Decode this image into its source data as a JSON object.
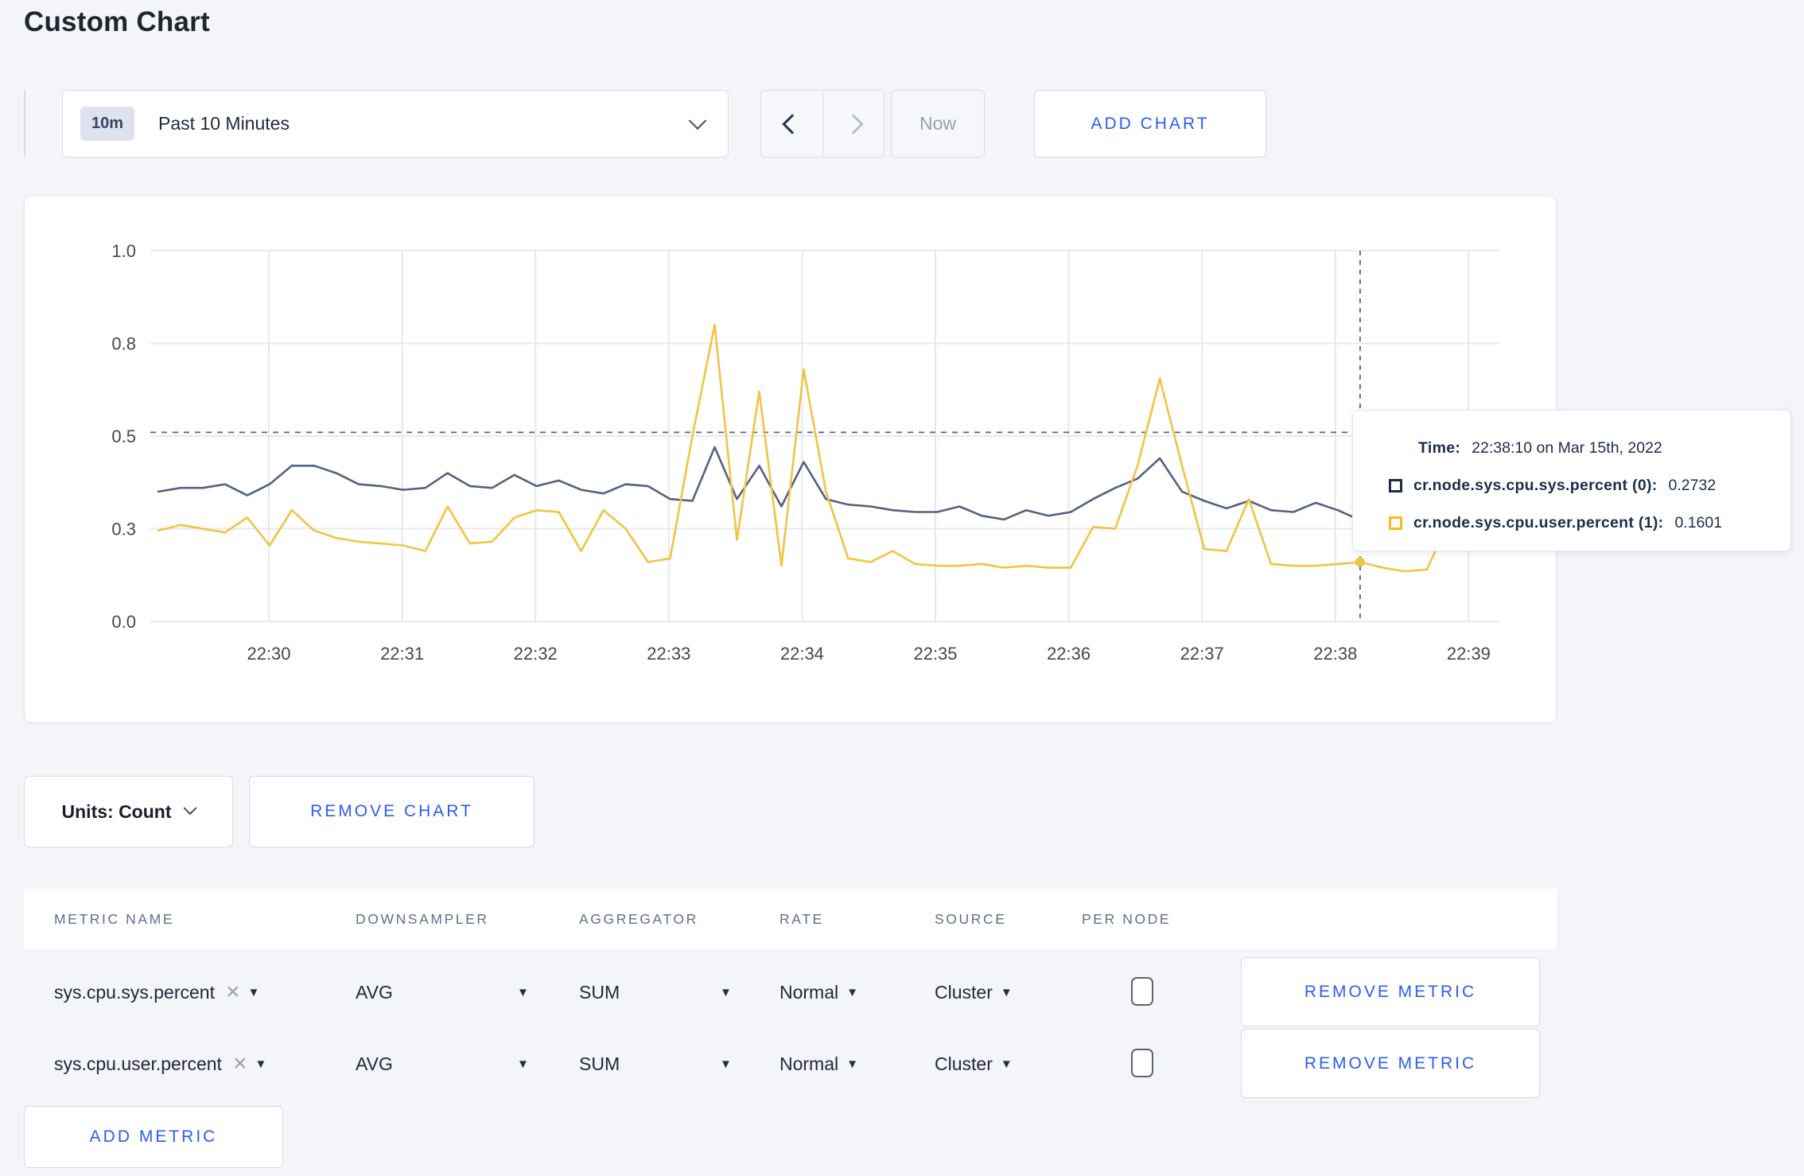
{
  "page": {
    "title": "Custom Chart"
  },
  "colors": {
    "accent_blue": "#2c5cf2",
    "background": "#f3f5f9",
    "series_sys_line": "#53627e",
    "series_user_line": "#f2c343",
    "legend_sys_square": "#1d2c49",
    "legend_user_square": "#f5bd16",
    "grid_line": "#e9eaee",
    "crosshair": "#54657f"
  },
  "toolbar": {
    "time_range_badge": "10m",
    "time_range_label": "Past 10 Minutes",
    "now_label": "Now",
    "add_chart_label": "ADD CHART"
  },
  "chart_data": {
    "type": "line",
    "title": "",
    "xlabel": "",
    "ylabel": "",
    "x_start": "22:29:10",
    "x_interval_seconds": 10,
    "x_tick_labels": [
      "22:30",
      "22:31",
      "22:32",
      "22:33",
      "22:34",
      "22:35",
      "22:36",
      "22:37",
      "22:38",
      "22:39"
    ],
    "y_ticks": [
      {
        "value": 0.0,
        "label": "0.0"
      },
      {
        "value": 0.25,
        "label": "0.3"
      },
      {
        "value": 0.5,
        "label": "0.5"
      },
      {
        "value": 0.75,
        "label": "0.8"
      },
      {
        "value": 1.0,
        "label": "1.0"
      }
    ],
    "ylim": [
      0,
      1
    ],
    "grid": true,
    "guideline_value": 0.51,
    "crosshair_index": 54,
    "series": [
      {
        "name": "cr.node.sys.cpu.sys.percent (0)",
        "color": "#53627e",
        "values": [
          0.35,
          0.36,
          0.36,
          0.37,
          0.34,
          0.37,
          0.42,
          0.42,
          0.4,
          0.37,
          0.365,
          0.355,
          0.36,
          0.4,
          0.365,
          0.36,
          0.395,
          0.365,
          0.38,
          0.355,
          0.345,
          0.37,
          0.365,
          0.33,
          0.325,
          0.47,
          0.33,
          0.42,
          0.31,
          0.43,
          0.33,
          0.315,
          0.31,
          0.3,
          0.295,
          0.295,
          0.31,
          0.285,
          0.275,
          0.3,
          0.285,
          0.295,
          0.33,
          0.36,
          0.385,
          0.44,
          0.35,
          0.325,
          0.305,
          0.325,
          0.3,
          0.295,
          0.32,
          0.3,
          0.2732,
          0.29,
          0.3,
          0.33,
          0.305,
          0.315,
          0.31
        ]
      },
      {
        "name": "cr.node.sys.cpu.user.percent (1)",
        "color": "#f2c343",
        "values": [
          0.245,
          0.26,
          0.25,
          0.24,
          0.28,
          0.205,
          0.3,
          0.245,
          0.225,
          0.215,
          0.21,
          0.205,
          0.19,
          0.31,
          0.21,
          0.215,
          0.28,
          0.3,
          0.295,
          0.19,
          0.3,
          0.25,
          0.16,
          0.17,
          0.5,
          0.8,
          0.22,
          0.62,
          0.15,
          0.68,
          0.35,
          0.17,
          0.16,
          0.19,
          0.155,
          0.15,
          0.15,
          0.155,
          0.145,
          0.15,
          0.145,
          0.145,
          0.255,
          0.25,
          0.42,
          0.655,
          0.42,
          0.195,
          0.19,
          0.33,
          0.155,
          0.15,
          0.15,
          0.155,
          0.1601,
          0.145,
          0.135,
          0.14,
          0.27,
          0.285,
          0.235
        ]
      }
    ]
  },
  "tooltip": {
    "time_label": "Time:",
    "time_value": "22:38:10 on Mar 15th, 2022",
    "rows": [
      {
        "label": "cr.node.sys.cpu.sys.percent (0):",
        "value": "0.2732",
        "square_color": "#1d2c49"
      },
      {
        "label": "cr.node.sys.cpu.user.percent (1):",
        "value": "0.1601",
        "square_color": "#f5bd16"
      }
    ]
  },
  "units_bar": {
    "units_label": "Units: Count",
    "remove_chart_label": "REMOVE CHART"
  },
  "metrics_table": {
    "headers": [
      "METRIC NAME",
      "DOWNSAMPLER",
      "AGGREGATOR",
      "RATE",
      "SOURCE",
      "PER NODE"
    ],
    "rows": [
      {
        "name": "sys.cpu.sys.percent",
        "downsampler": "AVG",
        "aggregator": "SUM",
        "rate": "Normal",
        "source": "Cluster",
        "per_node_checked": false,
        "remove_label": "REMOVE METRIC"
      },
      {
        "name": "sys.cpu.user.percent",
        "downsampler": "AVG",
        "aggregator": "SUM",
        "rate": "Normal",
        "source": "Cluster",
        "per_node_checked": false,
        "remove_label": "REMOVE METRIC"
      }
    ],
    "add_metric_label": "ADD METRIC"
  }
}
